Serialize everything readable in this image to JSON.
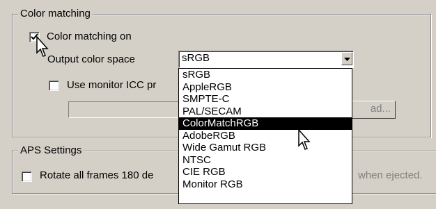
{
  "color_matching": {
    "legend": "Color matching",
    "checkbox_label": "Color matching on",
    "checkbox_checked": true,
    "output_space_label": "Output color space",
    "selected_value": "sRGB",
    "monitor_icc_label": "Use monitor ICC pr",
    "load_button_label": "ad..."
  },
  "dropdown": {
    "options": [
      "sRGB",
      "AppleRGB",
      "SMPTE-C",
      "PAL/SECAM",
      "ColorMatchRGB",
      "AdobeRGB",
      "Wide Gamut RGB",
      "NTSC",
      "CIE RGB",
      "Monitor RGB"
    ],
    "highlighted": "ColorMatchRGB"
  },
  "aps": {
    "legend": "APS Settings",
    "rotate_label": "Rotate all frames 180 de",
    "ejected_text": "when ejected."
  },
  "icons": {
    "check": "checkmark-icon",
    "arrow": "dropdown-arrow-icon",
    "cursor": "mouse-pointer-icon"
  }
}
